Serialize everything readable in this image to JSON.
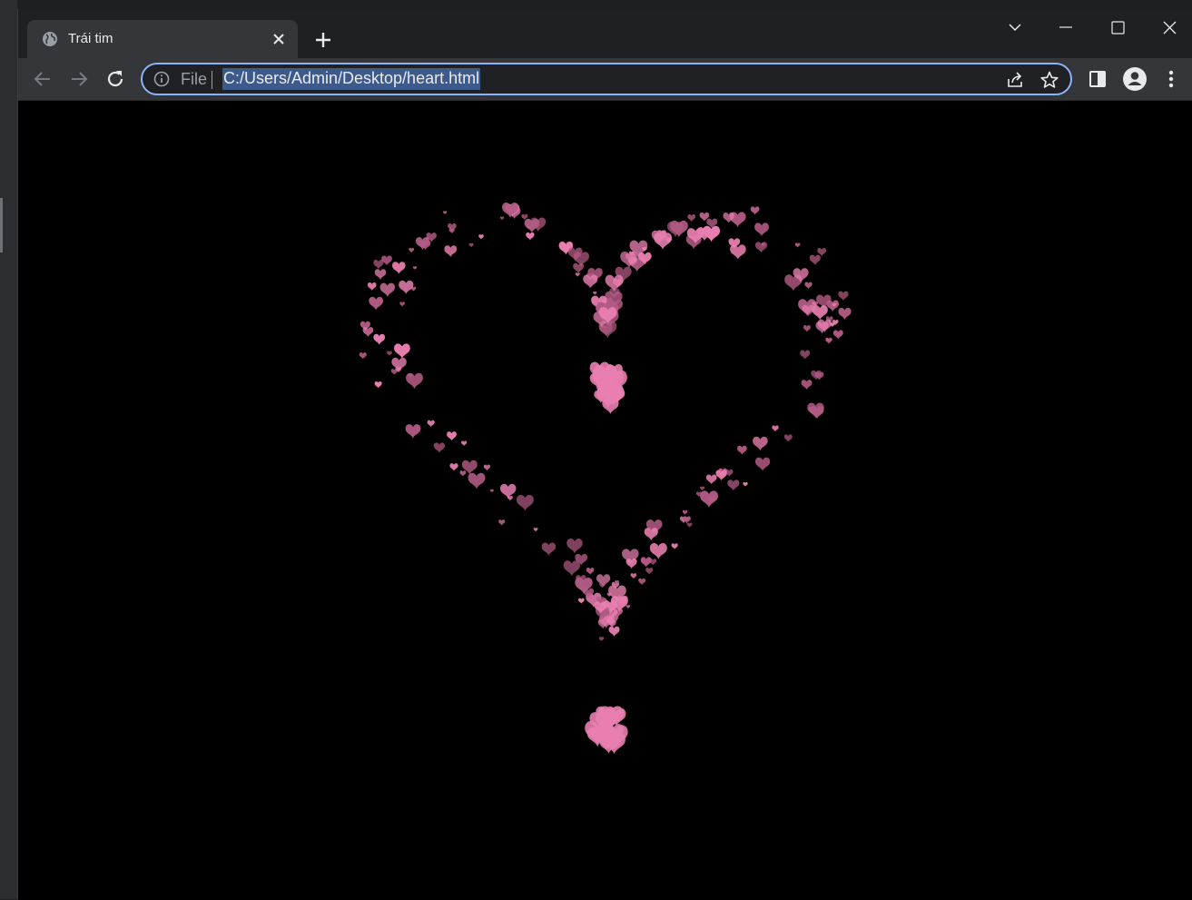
{
  "window": {
    "controls": [
      "tab-search-icon",
      "minimize-icon",
      "maximize-icon",
      "close-icon"
    ]
  },
  "tab": {
    "title": "Trái tim",
    "favicon": "globe-icon"
  },
  "toolbar": {
    "back_icon": "arrow-left-icon",
    "forward_icon": "arrow-right-icon",
    "reload_icon": "reload-icon"
  },
  "omnibox": {
    "scheme_label": "File",
    "url": "C:/Users/Admin/Desktop/heart.html",
    "focus_color": "#8ab4f8",
    "selection_color": "#3d5a8a"
  },
  "page": {
    "background": "#000000",
    "heart_color": "#e97fb0",
    "heart_color_dim": "#b35b84"
  }
}
